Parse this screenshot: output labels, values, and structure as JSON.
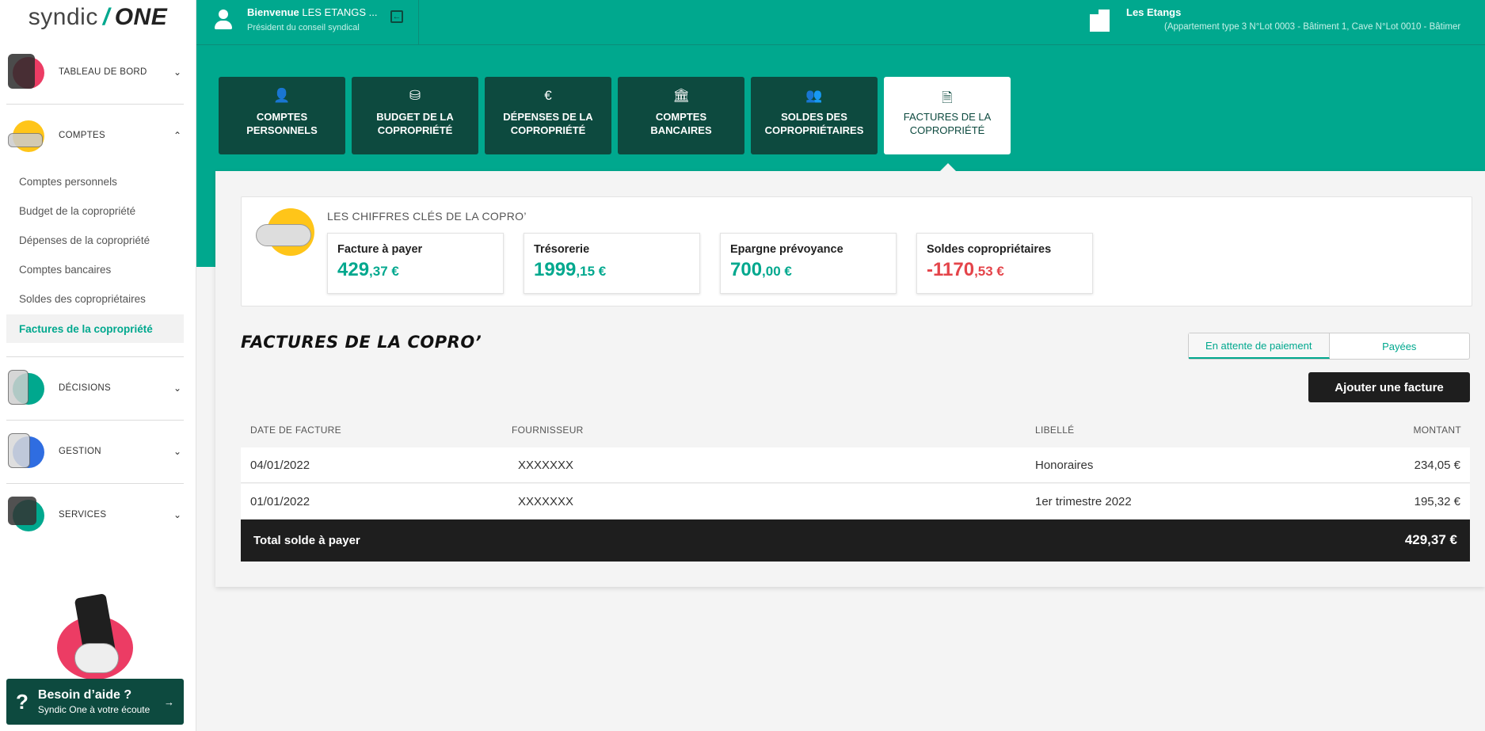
{
  "logo": {
    "part1": "syndic",
    "part2": "ONE"
  },
  "sidebar": {
    "sections": [
      {
        "label": "TABLEAU DE BORD",
        "chevron": "chevron-down"
      },
      {
        "label": "COMPTES",
        "chevron": "chevron-up"
      },
      {
        "label": "DÉCISIONS",
        "chevron": "chevron-down"
      },
      {
        "label": "GESTION",
        "chevron": "chevron-down"
      },
      {
        "label": "SERVICES",
        "chevron": "chevron-down"
      }
    ],
    "subitems": [
      {
        "label": "Comptes personnels",
        "active": false
      },
      {
        "label": "Budget de la copropriété",
        "active": false
      },
      {
        "label": "Dépenses de la copropriété",
        "active": false
      },
      {
        "label": "Comptes bancaires",
        "active": false
      },
      {
        "label": "Soldes des copropriétaires",
        "active": false
      },
      {
        "label": "Factures de la copropriété",
        "active": true
      }
    ],
    "help": {
      "title": "Besoin d’aide ?",
      "subtitle": "Syndic One à votre écoute"
    }
  },
  "header": {
    "welcome_bold": "Bienvenue",
    "welcome_name": "LES ETANGS ...",
    "role": "Président du conseil syndical",
    "residence_title": "Les Etangs",
    "residence_sub": "(Appartement type 3 N°Lot 0003 - Bâtiment 1, Cave N°Lot 0010 - Bâtimer"
  },
  "tabs": [
    {
      "label": "COMPTES PERSONNELS",
      "icon": "person-icon",
      "active": false
    },
    {
      "label": "BUDGET DE LA COPROPRIÉTÉ",
      "icon": "piggy-bank-icon",
      "active": false
    },
    {
      "label": "DÉPENSES DE LA COPROPRIÉTÉ",
      "icon": "hand-coin-icon",
      "active": false
    },
    {
      "label": "COMPTES BANCAIRES",
      "icon": "bank-icon",
      "active": false
    },
    {
      "label": "SOLDES DES COPROPRIÉTAIRES",
      "icon": "group-icon",
      "active": false
    },
    {
      "label": "FACTURES DE LA COPROPRIÉTÉ",
      "icon": "invoice-icon",
      "active": true
    }
  ],
  "kpis": {
    "title": "LES CHIFFRES CLÉS DE LA COPRO’",
    "cards": [
      {
        "label": "Facture à payer",
        "int": "429",
        "dec": ",37 €",
        "negative": false
      },
      {
        "label": "Trésorerie",
        "int": "1999",
        "dec": ",15 €",
        "negative": false
      },
      {
        "label": "Epargne prévoyance",
        "int": "700",
        "dec": ",00 €",
        "negative": false
      },
      {
        "label": "Soldes copropriétaires",
        "int": "-1170",
        "dec": ",53 €",
        "negative": true
      }
    ]
  },
  "invoices": {
    "title": "FACTURES DE LA COPRO’",
    "filter": {
      "pending": "En attente de paiement",
      "paid": "Payées",
      "active": "pending"
    },
    "add_button": "Ajouter une facture",
    "columns": [
      "DATE DE FACTURE",
      "FOURNISSEUR",
      "LIBELLÉ",
      "MONTANT"
    ],
    "rows": [
      {
        "date": "04/01/2022",
        "supplier": "XXXXXXX",
        "label": "Honoraires",
        "amount": "234,05 €"
      },
      {
        "date": "01/01/2022",
        "supplier": "XXXXXXX",
        "label": "1er trimestre 2022",
        "amount": "195,32 €"
      }
    ],
    "total_label": "Total solde à payer",
    "total_value": "429,37 €"
  },
  "colors": {
    "teal": "#00a88e",
    "dark_green": "#0d4a3f",
    "negative": "#e4444a",
    "pink": "#ec3c64",
    "yellow": "#ffc519"
  }
}
